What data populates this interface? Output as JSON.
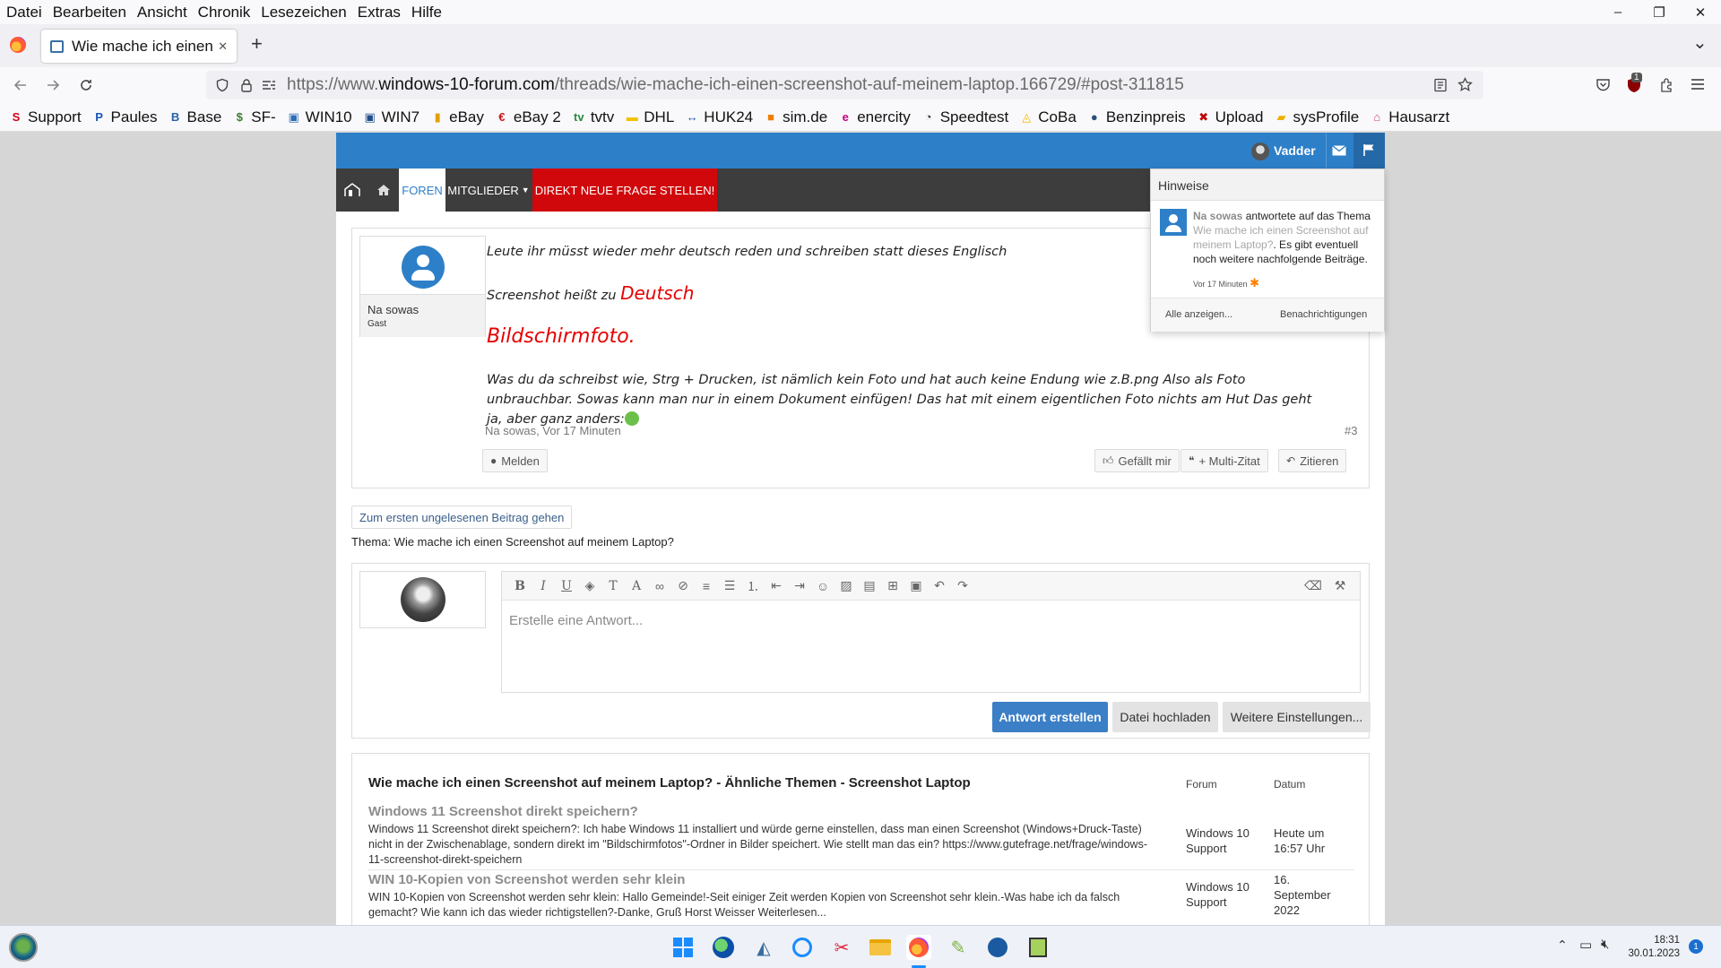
{
  "menubar": {
    "items": [
      "Datei",
      "Bearbeiten",
      "Ansicht",
      "Chronik",
      "Lesezeichen",
      "Extras",
      "Hilfe"
    ],
    "minimize": "–",
    "restore": "❐",
    "close": "✕"
  },
  "tab": {
    "title": "Wie mache ich einen Screenshot",
    "close": "✕",
    "new_tab": "+",
    "list_tabs": "⌄"
  },
  "nav": {
    "url_prefix": "https://www.",
    "url_domain": "windows-10-forum.com",
    "url_path": "/threads/wie-mache-ich-einen-screenshot-auf-meinem-laptop.166729/#post-311815",
    "badge": "1"
  },
  "bookmarks": [
    {
      "label": "Support",
      "glyph": "S",
      "color": "#d0021b"
    },
    {
      "label": "Paules",
      "glyph": "P",
      "color": "#1a57b5"
    },
    {
      "label": "Base",
      "glyph": "B",
      "color": "#2b5fa8"
    },
    {
      "label": "SF-",
      "glyph": "$",
      "color": "#3a7d2c"
    },
    {
      "label": "WIN10",
      "glyph": "▣",
      "color": "#2d6cb5"
    },
    {
      "label": "WIN7",
      "glyph": "▣",
      "color": "#1f4e8a"
    },
    {
      "label": "eBay",
      "glyph": "▮",
      "color": "#e0a100"
    },
    {
      "label": "eBay 2",
      "glyph": "€",
      "color": "#c4161c"
    },
    {
      "label": "tvtv",
      "glyph": "tv",
      "color": "#2b8a3e"
    },
    {
      "label": "DHL",
      "glyph": "▬",
      "color": "#f2c200"
    },
    {
      "label": "HUK24",
      "glyph": "↔",
      "color": "#1e5aa8"
    },
    {
      "label": "sim.de",
      "glyph": "■",
      "color": "#f07d00"
    },
    {
      "label": "enercity",
      "glyph": "e",
      "color": "#c6007e"
    },
    {
      "label": "Speedtest",
      "glyph": "◔",
      "color": "#333333"
    },
    {
      "label": "CoBa",
      "glyph": "◬",
      "color": "#f5b800"
    },
    {
      "label": "Benzinpreis",
      "glyph": "●",
      "color": "#2a4f7a"
    },
    {
      "label": "Upload",
      "glyph": "✖",
      "color": "#c00000"
    },
    {
      "label": "sysProfile",
      "glyph": "▰",
      "color": "#f0b000"
    },
    {
      "label": "Hausarzt",
      "glyph": "⌂",
      "color": "#c9406a"
    }
  ],
  "forum": {
    "user_name": "Vadder",
    "nav": {
      "foren": "FOREN",
      "mitglieder": "MITGLIEDER",
      "direkt": "DIREKT NEUE FRAGE STELLEN!"
    },
    "post": {
      "author": "Na sowas",
      "role": "Gast",
      "line1": "Leute ihr müsst wieder mehr deutsch reden und schreiben statt dieses Englisch",
      "line2_pre": "Screenshot heißt zu ",
      "line2_em": "Deutsch",
      "line3": "Bildschirmfoto.",
      "line4": "Was du da schreibst wie, Strg + Drucken, ist nämlich kein Foto und hat auch keine Endung wie z.B.png Also als Foto unbrauchbar. Sowas kann man nur in einem Dokument einfügen! Das hat mit einem eigentlichen Foto nichts am Hut Das geht ja, aber ganz anders:",
      "meta": "Na sowas, Vor 17 Minuten",
      "number": "#3",
      "report": "Melden",
      "like": "Gefällt mir",
      "multiquote": "+ Multi-Zitat",
      "quote": "Zitieren"
    },
    "goto_unread": "Zum ersten ungelesenen Beitrag gehen",
    "thread_label": "Thema: Wie mache ich einen Screenshot auf meinem Laptop?",
    "editor": {
      "placeholder": "Erstelle eine Antwort...",
      "submit": "Antwort erstellen",
      "upload": "Datei hochladen",
      "more": "Weitere Einstellungen..."
    },
    "related": {
      "heading": "Wie mache ich einen Screenshot auf meinem Laptop? - Ähnliche Themen - Screenshot Laptop",
      "col_forum": "Forum",
      "col_date": "Datum",
      "items": [
        {
          "title": "Windows 11 Screenshot direkt speichern?",
          "desc": "Windows 11 Screenshot direkt speichern?: Ich habe Windows 11 installiert und würde gerne einstellen, dass man einen Screenshot (Windows+Druck-Taste) nicht in der Zwischenablage, sondern direkt im \"Bildschirmfotos\"-Ordner in Bilder speichert. Wie stellt man das ein? https://www.gutefrage.net/frage/windows-11-screenshot-direkt-speichern",
          "forum": "Windows 10 Support",
          "date": "Heute um 16:57 Uhr"
        },
        {
          "title": "WIN 10-Kopien von Screenshot werden sehr klein",
          "desc": "WIN 10-Kopien von Screenshot werden sehr klein: Hallo Gemeinde!-Seit einiger Zeit werden Kopien von Screenshot sehr klein.-Was habe ich da falsch gemacht? Wie kann ich das wieder richtigstellen?-Danke, Gruß Horst Weisser Weiterlesen...",
          "forum": "Windows 10 Support",
          "date": "16. September 2022"
        }
      ]
    },
    "notifications": {
      "title": "Hinweise",
      "user": "Na sowas",
      "text1": " antwortete auf das Thema ",
      "thread": "Wie mache ich einen Screenshot auf meinem Laptop?",
      "text2": ". Es gibt eventuell noch weitere nachfolgende Beiträge.",
      "time": "Vor 17 Minuten",
      "show_all": "Alle anzeigen...",
      "settings": "Benachrichtigungen"
    }
  },
  "taskbar": {
    "time": "18:31",
    "date": "30.01.2023",
    "notif_count": "1"
  }
}
